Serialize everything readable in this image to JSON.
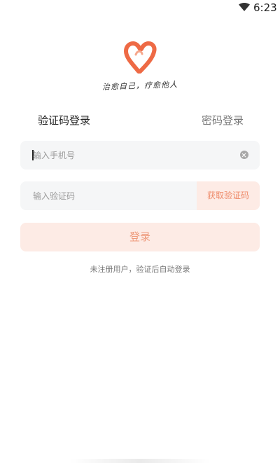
{
  "status_bar": {
    "time": "6:23",
    "wifi_icon": "wifi-icon"
  },
  "brand": {
    "logo_icon": "heart-logo-icon",
    "slogan": "治愈自己，疗愈他人",
    "accent_color": "#ee6a45"
  },
  "tabs": [
    {
      "label": "验证码登录",
      "active": true
    },
    {
      "label": "密码登录",
      "active": false
    }
  ],
  "form": {
    "phone_placeholder": "输入手机号",
    "code_placeholder": "输入验证码",
    "get_code_label": "获取验证码",
    "login_label": "登录",
    "hint": "未注册用户，验证后自动登录"
  }
}
